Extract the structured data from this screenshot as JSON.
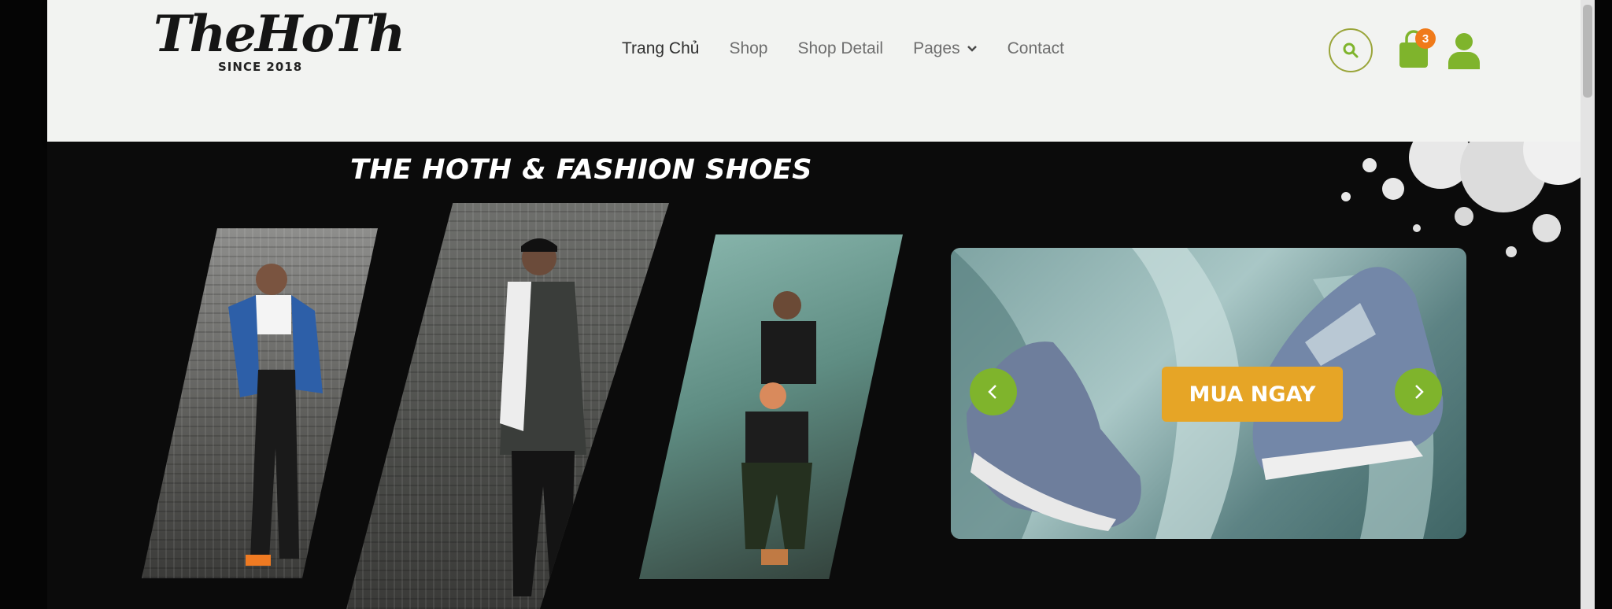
{
  "header": {
    "logo": {
      "main": "TheHoTh",
      "sub": "SINCE 2018"
    },
    "nav": [
      {
        "label": "Trang Chủ"
      },
      {
        "label": "Shop"
      },
      {
        "label": "Shop Detail"
      },
      {
        "label": "Pages"
      },
      {
        "label": "Contact"
      }
    ],
    "cart_count": "3",
    "icons": {
      "search": "search-icon",
      "cart": "shopping-bag-icon",
      "user": "user-icon"
    }
  },
  "hero": {
    "title": "THE HOTH & FASHION SHOES",
    "banner_button": "MUA NGAY",
    "prev_icon": "chevron-left-icon",
    "next_icon": "chevron-right-icon"
  },
  "colors": {
    "accent_green": "#7fb42c",
    "cta_orange": "#e6a526",
    "badge_orange": "#f07a1a",
    "header_bg": "#f2f3f1"
  }
}
